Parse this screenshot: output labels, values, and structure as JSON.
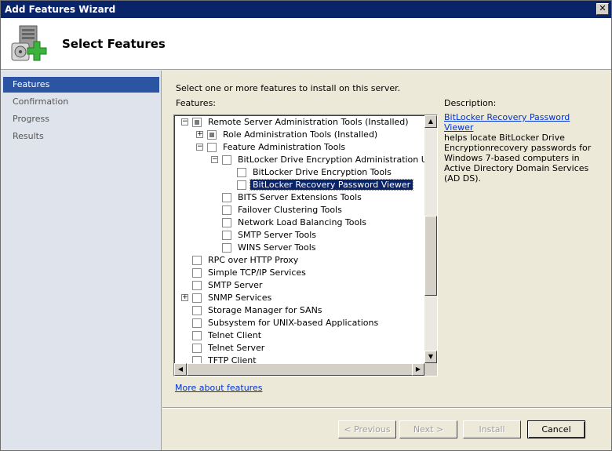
{
  "window": {
    "title": "Add Features Wizard"
  },
  "header": {
    "title": "Select Features"
  },
  "nav": {
    "items": [
      {
        "label": "Features",
        "active": true
      },
      {
        "label": "Confirmation",
        "active": false
      },
      {
        "label": "Progress",
        "active": false
      },
      {
        "label": "Results",
        "active": false
      }
    ]
  },
  "main": {
    "instruction": "Select one or more features to install on this server.",
    "features_label": "Features:",
    "description_label": "Description:",
    "description_link": "BitLocker Recovery Password Viewer",
    "description_text": "helps locate BitLocker Drive Encryptionrecovery passwords for Windows 7-based computers in Active Directory Domain Services (AD DS).",
    "more_link": "More about features"
  },
  "tree": [
    {
      "label": "Remote Server Administration Tools  (Installed)",
      "level": 0,
      "expander": "minus",
      "state": "indeterminate"
    },
    {
      "label": "Role Administration Tools  (Installed)",
      "level": 1,
      "expander": "plus",
      "state": "indeterminate"
    },
    {
      "label": "Feature Administration Tools",
      "level": 1,
      "expander": "minus",
      "state": "unchecked"
    },
    {
      "label": "BitLocker Drive Encryption Administration Utilities",
      "level": 2,
      "expander": "minus",
      "state": "unchecked"
    },
    {
      "label": "BitLocker Drive Encryption Tools",
      "level": 3,
      "expander": "none",
      "state": "unchecked"
    },
    {
      "label": "BitLocker Recovery Password Viewer",
      "level": 3,
      "expander": "none",
      "state": "unchecked",
      "selected": true
    },
    {
      "label": "BITS Server Extensions Tools",
      "level": 2,
      "expander": "none",
      "state": "unchecked"
    },
    {
      "label": "Failover Clustering Tools",
      "level": 2,
      "expander": "none",
      "state": "unchecked"
    },
    {
      "label": "Network Load Balancing Tools",
      "level": 2,
      "expander": "none",
      "state": "unchecked"
    },
    {
      "label": "SMTP Server Tools",
      "level": 2,
      "expander": "none",
      "state": "unchecked"
    },
    {
      "label": "WINS Server Tools",
      "level": 2,
      "expander": "none",
      "state": "unchecked"
    },
    {
      "label": "RPC over HTTP Proxy",
      "level": 0,
      "expander": "none",
      "state": "unchecked"
    },
    {
      "label": "Simple TCP/IP Services",
      "level": 0,
      "expander": "none",
      "state": "unchecked"
    },
    {
      "label": "SMTP Server",
      "level": 0,
      "expander": "none",
      "state": "unchecked"
    },
    {
      "label": "SNMP Services",
      "level": 0,
      "expander": "plus",
      "state": "unchecked"
    },
    {
      "label": "Storage Manager for SANs",
      "level": 0,
      "expander": "none",
      "state": "unchecked"
    },
    {
      "label": "Subsystem for UNIX-based Applications",
      "level": 0,
      "expander": "none",
      "state": "unchecked"
    },
    {
      "label": "Telnet Client",
      "level": 0,
      "expander": "none",
      "state": "unchecked"
    },
    {
      "label": "Telnet Server",
      "level": 0,
      "expander": "none",
      "state": "unchecked"
    },
    {
      "label": "TFTP Client",
      "level": 0,
      "expander": "none",
      "state": "unchecked"
    }
  ],
  "buttons": {
    "previous": "< Previous",
    "next": "Next >",
    "install": "Install",
    "cancel": "Cancel"
  },
  "icons": {
    "close": "close-icon",
    "wizard": "server-add-icon",
    "scroll_up": "scroll-up-icon",
    "scroll_down": "scroll-down-icon",
    "scroll_left": "scroll-left-icon",
    "scroll_right": "scroll-right-icon"
  },
  "colors": {
    "title_bar": "#0a246a",
    "nav_active": "#2b55a3",
    "link": "#0033cc",
    "selection": "#0a246a"
  }
}
